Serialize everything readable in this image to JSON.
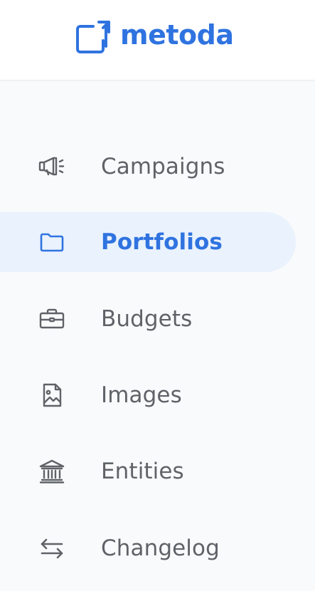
{
  "brand": {
    "name": "metoda",
    "accent_color": "#2f73e0"
  },
  "nav": {
    "items": [
      {
        "label": "Campaigns",
        "icon": "megaphone-icon",
        "active": false
      },
      {
        "label": "Portfolios",
        "icon": "folder-icon",
        "active": true
      },
      {
        "label": "Budgets",
        "icon": "briefcase-icon",
        "active": false
      },
      {
        "label": "Images",
        "icon": "image-icon",
        "active": false
      },
      {
        "label": "Entities",
        "icon": "bank-icon",
        "active": false
      },
      {
        "label": "Changelog",
        "icon": "swap-arrows-icon",
        "active": false
      }
    ]
  },
  "colors": {
    "active_background": "#e9f2fd",
    "inactive_text": "#5f6368"
  }
}
